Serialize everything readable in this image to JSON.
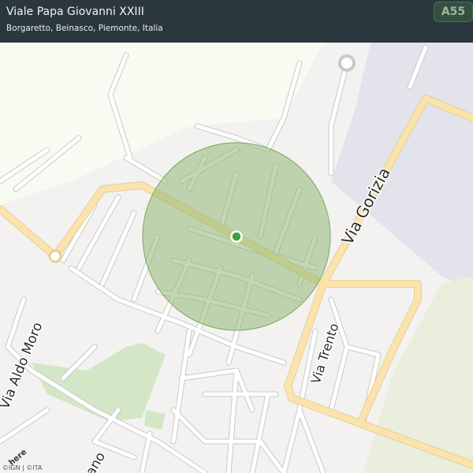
{
  "header": {
    "title": "Viale Papa Giovanni XXIII",
    "subtitle": "Borgaretto, Beinasco, Piemonte, Italia"
  },
  "map": {
    "road_labels": [
      "Via Gorizia",
      "Via Trento",
      "Via Aldo Moro",
      "ano"
    ],
    "highway_shield": "A55",
    "logo": "here",
    "attribution": "©IGN | ©ITA",
    "colors": {
      "background": "#f3f2f1",
      "park": "#d3e6c6",
      "industrial": "#e3e3ec",
      "open_land": "#f7fbf1",
      "main_road": "#fbe3ad",
      "radius_circle": "#8fb874",
      "location_dot": "#3aa344"
    },
    "icons": [
      "location-dot-icon",
      "radius-circle"
    ]
  }
}
